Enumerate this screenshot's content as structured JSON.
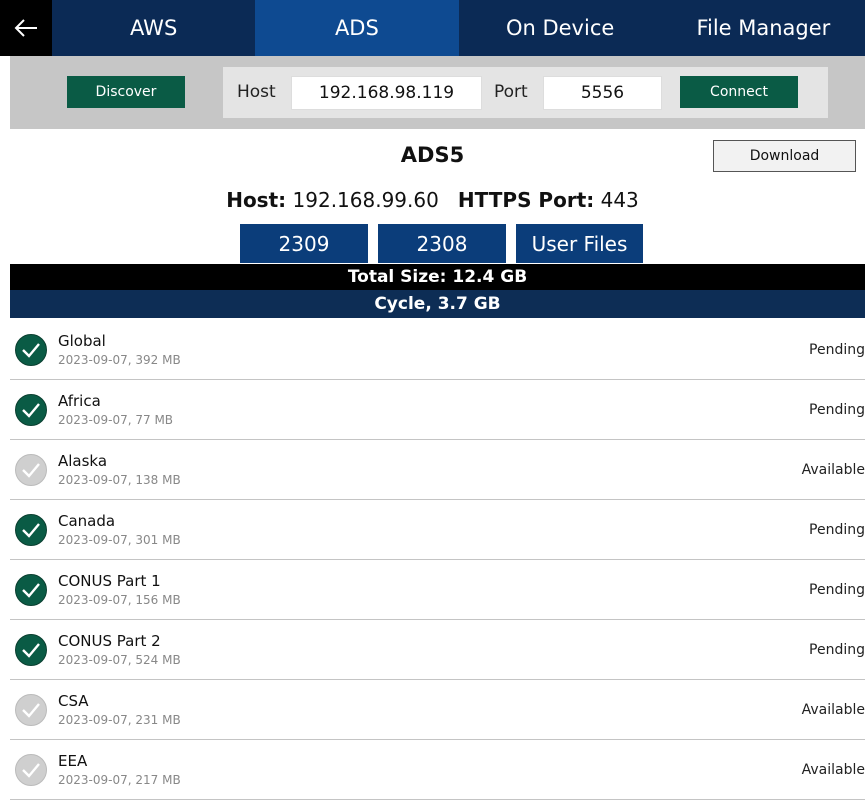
{
  "tabs": [
    {
      "label": "AWS",
      "active": false
    },
    {
      "label": "ADS",
      "active": true
    },
    {
      "label": "On Device",
      "active": false
    },
    {
      "label": "File Manager",
      "active": false
    }
  ],
  "connection": {
    "discover_label": "Discover",
    "host_label": "Host",
    "host_value": "192.168.98.119",
    "port_label": "Port",
    "port_value": "5556",
    "connect_label": "Connect"
  },
  "device": {
    "name": "ADS5",
    "download_label": "Download",
    "host_label": "Host:",
    "host_value": "192.168.99.60",
    "https_label": "HTTPS Port:",
    "https_value": "443"
  },
  "cycle_buttons": [
    "2309",
    "2308",
    "User Files"
  ],
  "total_size": "Total Size: 12.4 GB",
  "cycle_header": "Cycle, 3.7 GB",
  "items": [
    {
      "name": "Global",
      "sub": "2023-09-07, 392 MB",
      "status": "Pending",
      "checked": true
    },
    {
      "name": "Africa",
      "sub": "2023-09-07, 77 MB",
      "status": "Pending",
      "checked": true
    },
    {
      "name": "Alaska",
      "sub": "2023-09-07, 138 MB",
      "status": "Available",
      "checked": false
    },
    {
      "name": "Canada",
      "sub": "2023-09-07, 301 MB",
      "status": "Pending",
      "checked": true
    },
    {
      "name": "CONUS Part 1",
      "sub": "2023-09-07, 156 MB",
      "status": "Pending",
      "checked": true
    },
    {
      "name": "CONUS Part 2",
      "sub": "2023-09-07, 524 MB",
      "status": "Pending",
      "checked": true
    },
    {
      "name": "CSA",
      "sub": "2023-09-07, 231 MB",
      "status": "Available",
      "checked": false
    },
    {
      "name": "EEA",
      "sub": "2023-09-07, 217 MB",
      "status": "Available",
      "checked": false
    }
  ],
  "colors": {
    "tabbar": "#0b2a55",
    "tab_active": "#0e4a91",
    "green": "#0a5b45",
    "unchecked": "#cfcfcf"
  }
}
